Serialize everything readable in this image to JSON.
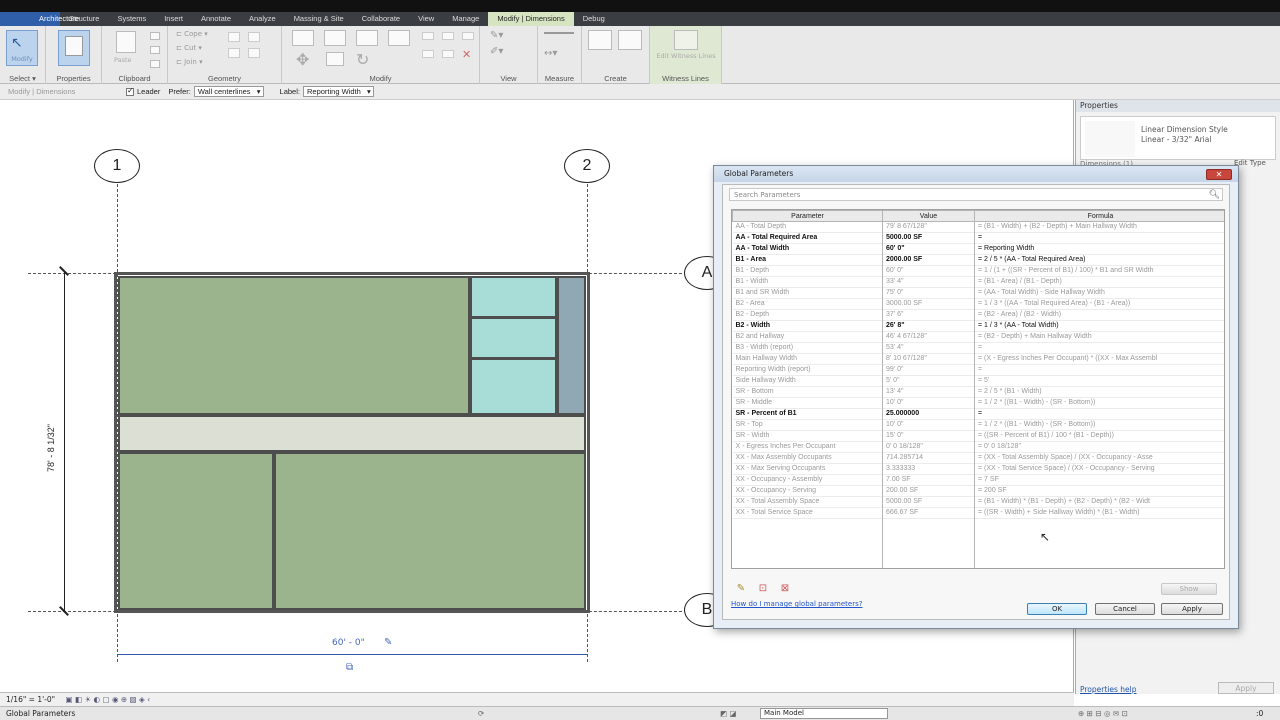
{
  "ribbon": {
    "app_button": "",
    "tabs": [
      "Architecture",
      "Structure",
      "Systems",
      "Insert",
      "Annotate",
      "Analyze",
      "Massing & Site",
      "Collaborate",
      "View",
      "Manage",
      "Modify | Dimensions",
      "Debug"
    ],
    "panels": {
      "select": "Select ▾",
      "properties": "Properties",
      "clipboard": "Clipboard",
      "geometry": "Geometry",
      "modify": "Modify",
      "view": "View",
      "measure": "Measure",
      "create": "Create",
      "witness": "Witness Lines"
    },
    "modify_btn": "Modify",
    "paste_btn": "Paste",
    "edit_witness": "Edit Witness Lines",
    "geometry_items": [
      "Cope",
      "Cut",
      "Join"
    ]
  },
  "options_bar": {
    "context": "Modify | Dimensions",
    "leader": "Leader",
    "prefer_label": "Prefer:",
    "prefer_value": "Wall centerlines",
    "label_label": "Label:",
    "label_value": "Reporting Width"
  },
  "drawing": {
    "grid_1": "1",
    "grid_2": "2",
    "grid_a": "A",
    "grid_b": "B",
    "vertical_dim": "78' - 8 1/32\"",
    "horizontal_dim": "60' - 0\""
  },
  "properties": {
    "title": "Properties",
    "type_line1": "Linear Dimension Style",
    "type_line2": "Linear - 3/32\" Arial",
    "instance_dropdown": "Dimensions (1)",
    "edit_type": "Edit Type",
    "help": "Properties help",
    "apply": "Apply"
  },
  "view_control": {
    "scale": "1/16\" = 1'-0\""
  },
  "status": {
    "text": "Global Parameters",
    "model": "Main Model",
    "filter_count": ":0"
  },
  "dialog": {
    "title": "Global Parameters",
    "close": "✕",
    "search_placeholder": "Search Parameters",
    "headers": [
      "Parameter",
      "Value",
      "Formula"
    ],
    "rows": [
      {
        "p": "AA - Total Depth",
        "v": "79' 8 67/128\"",
        "f": "= (B1 - Width) + (B2 - Depth) + Main Hallway Width",
        "e": false
      },
      {
        "p": "AA - Total Required Area",
        "v": "5000.00 SF",
        "f": "=",
        "e": true
      },
      {
        "p": "AA - Total Width",
        "v": "60' 0\"",
        "f": "= Reporting Width",
        "e": true
      },
      {
        "p": "B1 - Area",
        "v": "2000.00 SF",
        "f": "= 2 / 5 * (AA - Total Required Area)",
        "e": true
      },
      {
        "p": "B1 - Depth",
        "v": "60' 0\"",
        "f": "= 1 / (1 + ((SR - Percent of B1) / 100) * B1 and SR Width",
        "e": false
      },
      {
        "p": "B1 - Width",
        "v": "33' 4\"",
        "f": "= (B1 - Area) / (B1 - Depth)",
        "e": false
      },
      {
        "p": "B1 and SR Width",
        "v": "75' 0\"",
        "f": "= (AA - Total Width) - Side Hallway Width",
        "e": false
      },
      {
        "p": "B2 - Area",
        "v": "3000.00 SF",
        "f": "= 1 / 3 * ((AA - Total Required Area) - (B1 - Area))",
        "e": false
      },
      {
        "p": "B2 - Depth",
        "v": "37' 6\"",
        "f": "= (B2 - Area) / (B2 - Width)",
        "e": false
      },
      {
        "p": "B2 - Width",
        "v": "26' 8\"",
        "f": "= 1 / 3 * (AA - Total Width)",
        "e": true
      },
      {
        "p": "B2 and Hallway",
        "v": "46' 4 67/128\"",
        "f": "= (B2 - Depth) + Main Hallway Width",
        "e": false
      },
      {
        "p": "B3 - Width (report)",
        "v": "53' 4\"",
        "f": "=",
        "e": false
      },
      {
        "p": "Main Hallway Width",
        "v": "8' 10 67/128\"",
        "f": "= (X - Egress Inches Per Occupant) * ((XX - Max Assembl",
        "e": false
      },
      {
        "p": "Reporting Width (report)",
        "v": "99' 0\"",
        "f": "=",
        "e": false
      },
      {
        "p": "Side Hallway Width",
        "v": "5' 0\"",
        "f": "= 5'",
        "e": false
      },
      {
        "p": "SR - Bottom",
        "v": "13' 4\"",
        "f": "= 2 / 5 * (B1 - Width)",
        "e": false
      },
      {
        "p": "SR - Middle",
        "v": "10' 0\"",
        "f": "= 1 / 2 * ((B1 - Width) - (SR - Bottom))",
        "e": false
      },
      {
        "p": "SR - Percent of B1",
        "v": "25.000000",
        "f": "=",
        "e": true
      },
      {
        "p": "SR - Top",
        "v": "10' 0\"",
        "f": "= 1 / 2 * ((B1 - Width) - (SR - Bottom))",
        "e": false
      },
      {
        "p": "SR - Width",
        "v": "15' 0\"",
        "f": "= ((SR - Percent of B1) / 100 * (B1 - Depth))",
        "e": false
      },
      {
        "p": "X - Egress Inches Per Occupant",
        "v": "0' 0 18/128\"",
        "f": "= 0' 0 18/128\"",
        "e": false
      },
      {
        "p": "XX - Max Assembly Occupants",
        "v": "714.285714",
        "f": "= (XX - Total Assembly Space) / (XX - Occupancy - Asse",
        "e": false
      },
      {
        "p": "XX - Max Serving Occupants",
        "v": "3.333333",
        "f": "= (XX - Total Service Space) / (XX - Occupancy - Serving",
        "e": false
      },
      {
        "p": "XX - Occupancy - Assembly",
        "v": "7.00 SF",
        "f": "= 7 SF",
        "e": false
      },
      {
        "p": "XX - Occupancy - Serving",
        "v": "200.00 SF",
        "f": "= 200 SF",
        "e": false
      },
      {
        "p": "XX - Total Assembly Space",
        "v": "5000.00 SF",
        "f": "= (B1 - Width) * (B1 - Depth) + (B2 - Depth) * (B2 - Widt",
        "e": false
      },
      {
        "p": "XX - Total Service Space",
        "v": "666.67 SF",
        "f": "= ((SR - Width) + Side Hallway Width) * (B1 - Width)",
        "e": false
      }
    ],
    "help_link": "How do I manage global parameters?",
    "show_btn": "Show",
    "ok": "OK",
    "cancel": "Cancel",
    "apply": "Apply"
  },
  "colors": {
    "room_green": "#9cb48e",
    "room_cyan": "#a8dcd6",
    "room_blue": "#8fa8b3",
    "hallway": "#dcdfd3",
    "modify_context_tab": "#d7e4c2"
  }
}
